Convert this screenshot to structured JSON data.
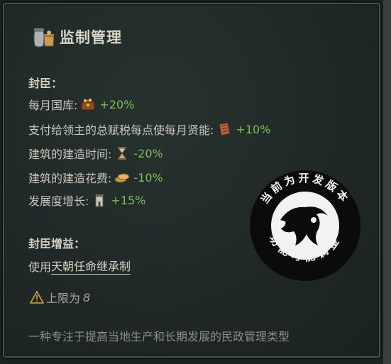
{
  "tooltip": {
    "title": "监制管理",
    "vassals_header": "封臣：",
    "monthly_treasury": {
      "label": "每月国库:",
      "value": "+20%"
    },
    "tax_to_prestige": {
      "label": "支付给领主的总赋税每点使每月贤能:",
      "value": "+10%"
    },
    "build_time": {
      "label": "建筑的建造时间:",
      "value": "-20%"
    },
    "build_cost": {
      "label": "建筑的建造花费:",
      "value": "-10%"
    },
    "development": {
      "label": "发展度增长:",
      "value": "+15%"
    },
    "vassal_bonus_header": "封臣增益：",
    "use_prefix": "使用",
    "use_link": "天朝任命继承制",
    "limit_label": "上限为",
    "limit_value": "8",
    "description": "一种专注于提高当地生产和长期发展的民政管理类型"
  },
  "watermark": {
    "top_text": "当前为开发版本",
    "bottom_text": "功能可能调整"
  },
  "colors": {
    "positive": "#7fbf57",
    "text": "#c9c6bb",
    "panel_bg": "#1f2826"
  },
  "icons": [
    "jars-icon",
    "treasure-chest-icon",
    "scroll-icon",
    "hourglass-icon",
    "coins-icon",
    "tower-icon",
    "warning-icon"
  ]
}
